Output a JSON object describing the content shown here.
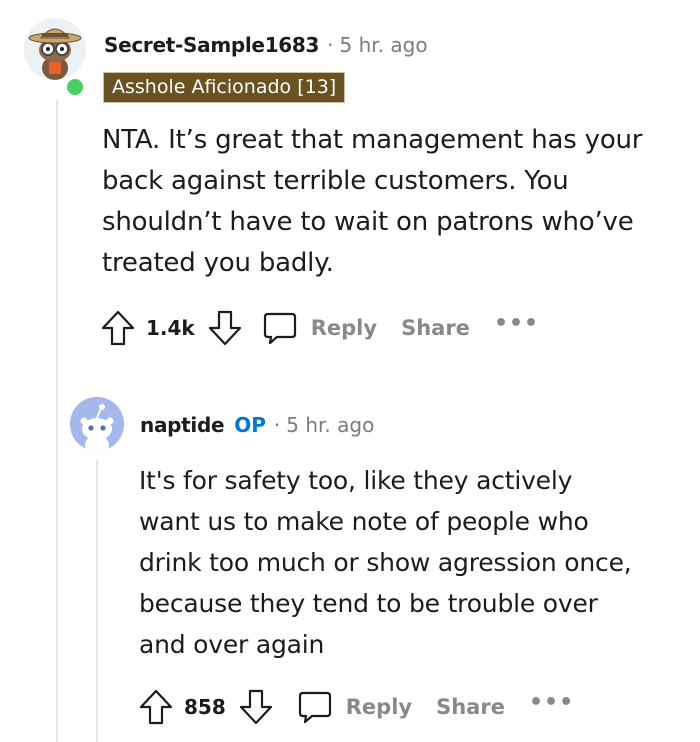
{
  "comment": {
    "username": "Secret-Sample1683",
    "separator": "·",
    "time": "5 hr. ago",
    "flair": "Asshole Aficionado [13]",
    "body": "NTA. It’s great that management has your back against terrible customers. You shouldn’t have to wait on patrons who’ve treated you badly.",
    "score": "1.4k",
    "reply_label": "Reply",
    "share_label": "Share",
    "more_label": "•••",
    "colors": {
      "flair_bg": "#6a5122",
      "online": "#46d160"
    }
  },
  "reply": {
    "username": "naptide",
    "op_badge": "OP",
    "separator": "·",
    "time": "5 hr. ago",
    "body": "It's for safety too, like they actively want us to make note of people who drink too much or show agression once, because they tend to be trouble over and over again",
    "score": "858",
    "reply_label": "Reply",
    "share_label": "Share",
    "more_label": "•••",
    "colors": {
      "op": "#0079d3",
      "avatar_bg": "#a5b8ec"
    }
  }
}
